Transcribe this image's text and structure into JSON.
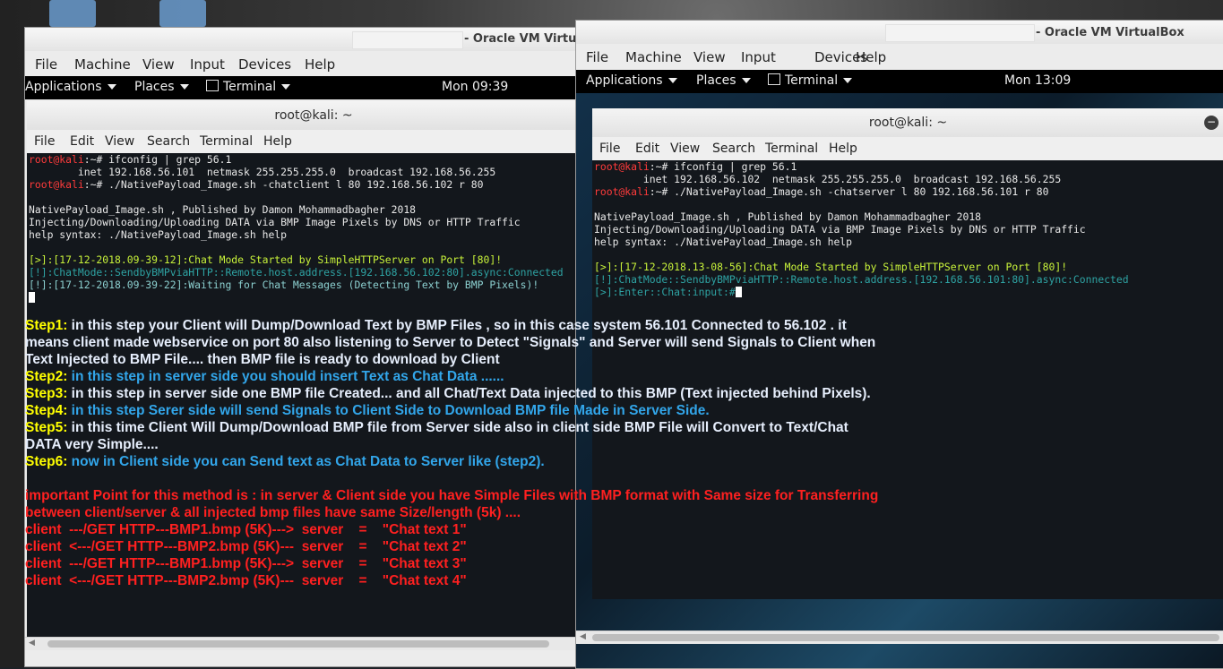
{
  "left_vm": {
    "title": "- Oracle VM Virtu",
    "menu": [
      "File",
      "Machine",
      "View",
      "Input",
      "Devices",
      "Help"
    ],
    "panel": {
      "applications": "Applications",
      "places": "Places",
      "terminal": "Terminal",
      "clock": "Mon 09:39"
    },
    "terminal": {
      "title": "root@kali: ~",
      "menu": [
        "File",
        "Edit",
        "View",
        "Search",
        "Terminal",
        "Help"
      ],
      "lines": [
        {
          "prompt": "root@kali",
          "rest": ":~# ifconfig | grep 56.1"
        },
        {
          "text": "        inet 192.168.56.101  netmask 255.255.255.0  broadcast 192.168.56.255"
        },
        {
          "prompt": "root@kali",
          "rest": ":~# ./NativePayload_Image.sh -chatclient l 80 192.168.56.102 r 80"
        },
        {
          "text": ""
        },
        {
          "text": "NativePayload_Image.sh , Published by Damon Mohammadbagher 2018"
        },
        {
          "text": "Injecting/Downloading/Uploading DATA via BMP Image Pixels by DNS or HTTP Traffic"
        },
        {
          "text": "help syntax: ./NativePayload_Image.sh help"
        },
        {
          "text": ""
        },
        {
          "green": "[>]:[17-12-2018.09-39-12]:Chat Mode Started by SimpleHTTPServer on Port [80]!"
        },
        {
          "teal": "[!]:ChatMode::SendbyBMPviaHTTP::Remote.host.address.[192.168.56.102:80].async:Connected"
        },
        {
          "dim": "[!]:[17-12-2018.09-39-22]:Waiting for Chat Messages (Detecting Text by BMP Pixels)!"
        }
      ]
    }
  },
  "right_vm": {
    "title": "- Oracle VM VirtualBox",
    "menu": [
      "File",
      "Machine",
      "View",
      "Input",
      "Devices",
      "Help"
    ],
    "panel": {
      "applications": "Applications",
      "places": "Places",
      "terminal": "Terminal",
      "clock": "Mon 13:09"
    },
    "terminal": {
      "title": "root@kali: ~",
      "menu": [
        "File",
        "Edit",
        "View",
        "Search",
        "Terminal",
        "Help"
      ],
      "lines": [
        {
          "prompt": "root@kali",
          "rest": ":~# ifconfig | grep 56.1"
        },
        {
          "text": "        inet 192.168.56.102  netmask 255.255.255.0  broadcast 192.168.56.255"
        },
        {
          "prompt": "root@kali",
          "rest": ":~# ./NativePayload_Image.sh -chatserver l 80 192.168.56.101 r 80"
        },
        {
          "text": ""
        },
        {
          "text": "NativePayload_Image.sh , Published by Damon Mohammadbagher 2018"
        },
        {
          "text": "Injecting/Downloading/Uploading DATA via BMP Image Pixels by DNS or HTTP Traffic"
        },
        {
          "text": "help syntax: ./NativePayload_Image.sh help"
        },
        {
          "text": ""
        },
        {
          "green": "[>]:[17-12-2018.13-08-56]:Chat Mode Started by SimpleHTTPServer on Port [80]!"
        },
        {
          "teal": "[!]:ChatMode::SendbyBMPviaHTTP::Remote.host.address.[192.168.56.101:80].async:Connected"
        },
        {
          "teal": "[>]:Enter::Chat:input:#"
        }
      ]
    }
  },
  "notes": {
    "steps": [
      {
        "label": "Step1:",
        "text": " in this step your Client will Dump/Download Text by BMP Files , so in this case system 56.101 Connected to 56.102 . it\nmeans client made webservice on port 80 also listening to Server to Detect \"Signals\" and Server will send Signals to Client when\nText Injected to BMP File.... then BMP file is ready to download by Client",
        "color": "wh"
      },
      {
        "label": "Step2:",
        "text": " in this step in server side you should insert Text as Chat Data ......",
        "color": "cy"
      },
      {
        "label": "Step3:",
        "text": " in this step in server side one BMP file Created... and all Chat/Text Data injected to this BMP (Text injected behind Pixels).",
        "color": "wh"
      },
      {
        "label": "Step4:",
        "text": " in this step Serer side will send Signals to Client Side to Download BMP file Made in Server Side.",
        "color": "cy"
      },
      {
        "label": "Step5:",
        "text": " in this time Client Will Dump/Download BMP file from Server side also in client side BMP File will Convert to Text/Chat\nDATA very Simple....",
        "color": "wh"
      },
      {
        "label": "Step6:",
        "text": " now in Client side you can Send text as Chat Data to Server like (step2).",
        "color": "cy"
      }
    ],
    "important": [
      "important Point for this method is : in server & Client side you have Simple Files with BMP format with Same size for Transferring",
      "between client/server & all injected bmp files have same Size/length (5k) ....",
      "client  ---/GET HTTP---BMP1.bmp (5K)--->  server    =    \"Chat text 1\"",
      "client  <---/GET HTTP---BMP2.bmp (5K)---  server    =    \"Chat text 2\"",
      "client  ---/GET HTTP---BMP1.bmp (5K)--->  server    =    \"Chat text 3\"",
      "client  <---/GET HTTP---BMP2.bmp (5K)---  server    =    \"Chat text 4\""
    ]
  },
  "colors": {
    "prompt": "#ff3b3b",
    "step_label": "#ffff00",
    "important": "#ff2020"
  }
}
